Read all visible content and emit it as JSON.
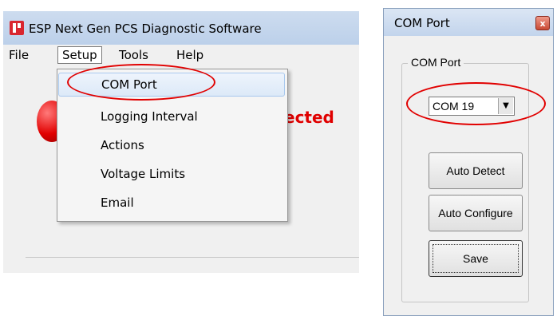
{
  "app": {
    "title": "ESP Next Gen PCS Diagnostic Software",
    "menu": [
      "File",
      "Setup",
      "Tools",
      "Help"
    ],
    "status_text": "ected"
  },
  "setup_menu": {
    "items": [
      "COM Port",
      "Logging Interval",
      "Actions",
      "Voltage Limits",
      "Email"
    ]
  },
  "dialog": {
    "title": "COM Port",
    "close_glyph": "x",
    "group_label": "COM Port",
    "com_value": "COM 19",
    "buttons": [
      "Auto Detect",
      "Auto Configure",
      "Save"
    ]
  },
  "colors": {
    "annotation": "#e10000",
    "status_led": "#e10000",
    "status_text": "#e00000",
    "app_icon": "#d9262f"
  },
  "icons": {
    "app": "app-logo-icon",
    "led": "status-led-icon",
    "dropdown": "chevron-down-icon",
    "close": "close-icon"
  }
}
